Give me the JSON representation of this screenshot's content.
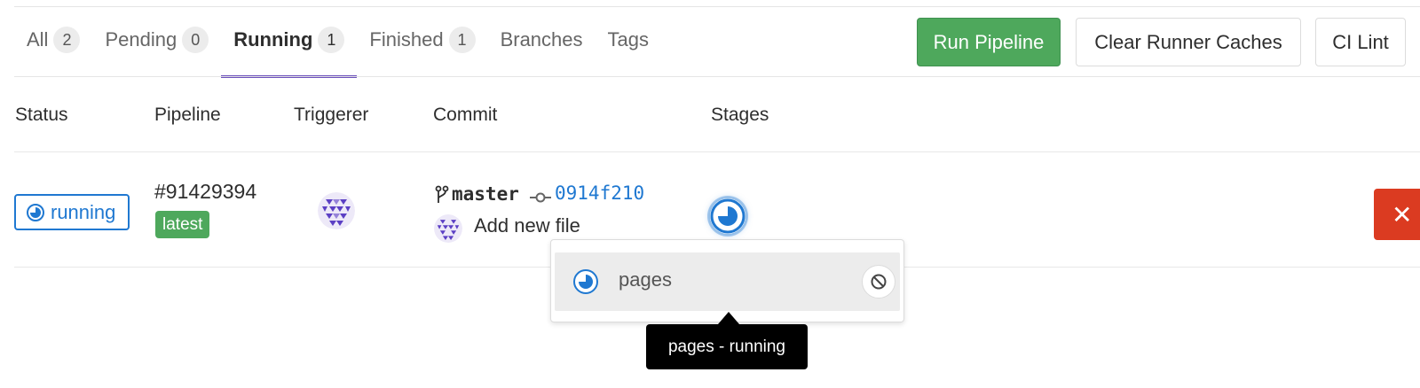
{
  "tabs": [
    {
      "label": "All",
      "count": "2"
    },
    {
      "label": "Pending",
      "count": "0"
    },
    {
      "label": "Running",
      "count": "1"
    },
    {
      "label": "Finished",
      "count": "1"
    },
    {
      "label": "Branches"
    },
    {
      "label": "Tags"
    }
  ],
  "active_tab": "Running",
  "actions": {
    "run_pipeline": "Run Pipeline",
    "clear_caches": "Clear Runner Caches",
    "ci_lint": "CI Lint"
  },
  "columns": {
    "status": "Status",
    "pipeline": "Pipeline",
    "triggerer": "Triggerer",
    "commit": "Commit",
    "stages": "Stages"
  },
  "pipeline_row": {
    "status": "running",
    "id": "#91429394",
    "badge": "latest",
    "branch": "master",
    "commit_sha": "0914f210",
    "commit_title": "Add new file",
    "stage_status": "running"
  },
  "stage_dropdown": {
    "job_name": "pages",
    "tooltip": "pages - running"
  },
  "icons": {
    "status": "status-running-icon",
    "branch": "fork-icon",
    "commit": "commit-icon",
    "cancel_job": "cancel-icon",
    "cancel_pipeline": "close-icon"
  },
  "colors": {
    "primary": "#1f78d1",
    "success": "#4ea85c",
    "danger": "#db3b21",
    "tab_active": "#6b4fbb"
  }
}
